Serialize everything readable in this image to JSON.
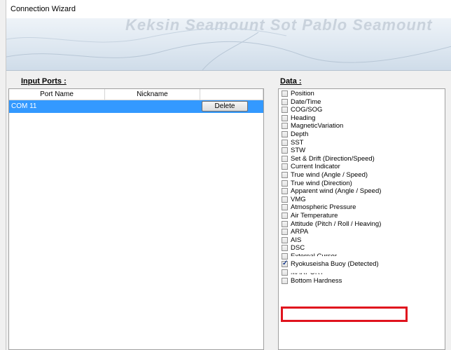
{
  "window": {
    "title": "Connection Wizard"
  },
  "banner": {
    "watermark": "Keksin Seamount Sot Pablo Seamount"
  },
  "input_ports": {
    "label": "Input Ports :",
    "columns": [
      "Port Name",
      "Nickname",
      ""
    ],
    "rows": [
      {
        "port_name": "COM 11",
        "nickname": "",
        "action": "Delete"
      }
    ]
  },
  "data": {
    "label": "Data :",
    "items": [
      {
        "label": "Position",
        "checked": false
      },
      {
        "label": "Date/Time",
        "checked": false
      },
      {
        "label": "COG/SOG",
        "checked": false
      },
      {
        "label": "Heading",
        "checked": false
      },
      {
        "label": "MagneticVariation",
        "checked": false
      },
      {
        "label": "Depth",
        "checked": false
      },
      {
        "label": "SST",
        "checked": false
      },
      {
        "label": "STW",
        "checked": false
      },
      {
        "label": "Set & Drift (Direction/Speed)",
        "checked": false
      },
      {
        "label": "Current Indicator",
        "checked": false
      },
      {
        "label": "True wind (Angle / Speed)",
        "checked": false
      },
      {
        "label": "True wind (Direction)",
        "checked": false
      },
      {
        "label": "Apparent wind (Angle / Speed)",
        "checked": false
      },
      {
        "label": "VMG",
        "checked": false
      },
      {
        "label": "Atmospheric Pressure",
        "checked": false
      },
      {
        "label": "Air Temperature",
        "checked": false
      },
      {
        "label": "Attitude (Pitch / Roll / Heaving)",
        "checked": false
      },
      {
        "label": "ARPA",
        "checked": false
      },
      {
        "label": "AIS",
        "checked": false
      },
      {
        "label": "DSC",
        "checked": false
      },
      {
        "label": "External Cursor",
        "checked": false
      },
      {
        "label": "Ryokuseisha Buoy (Detected)",
        "checked": true
      },
      {
        "label": "MARPORT",
        "checked": false
      },
      {
        "label": "Bottom Hardness",
        "checked": false
      }
    ]
  }
}
